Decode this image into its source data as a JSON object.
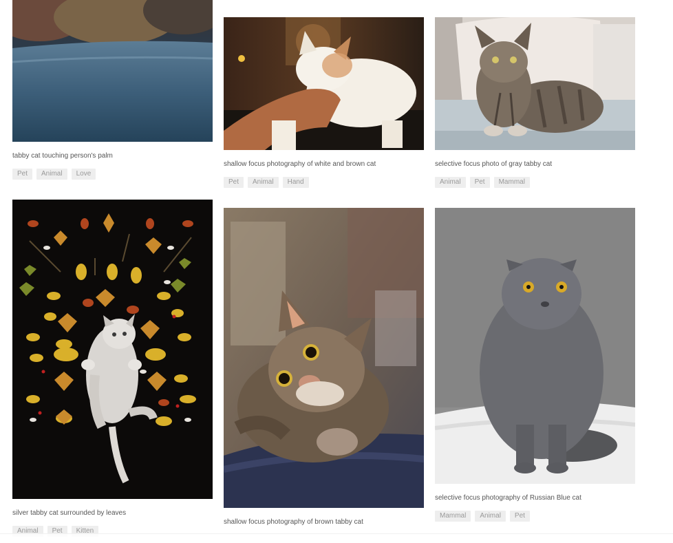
{
  "gallery": {
    "items": [
      {
        "image": "tabby-cat-palm-photo",
        "caption": "tabby cat touching person's palm",
        "tags": [
          "Pet",
          "Animal",
          "Love"
        ]
      },
      {
        "image": "white-brown-cat-hand-photo",
        "caption": "shallow focus photography of white and brown cat",
        "tags": [
          "Pet",
          "Animal",
          "Hand"
        ]
      },
      {
        "image": "gray-tabby-sofa-photo",
        "caption": "selective focus photo of gray tabby cat",
        "tags": [
          "Animal",
          "Pet",
          "Mammal"
        ]
      },
      {
        "image": "silver-tabby-leaves-photo",
        "caption": "silver tabby cat surrounded by leaves",
        "tags": [
          "Animal",
          "Pet",
          "Kitten"
        ]
      },
      {
        "image": "brown-tabby-closeup-photo",
        "caption": "shallow focus photography of brown tabby cat",
        "tags": []
      },
      {
        "image": "russian-blue-photo",
        "caption": "selective focus photography of Russian Blue cat",
        "tags": [
          "Mammal",
          "Animal",
          "Pet"
        ]
      }
    ]
  }
}
